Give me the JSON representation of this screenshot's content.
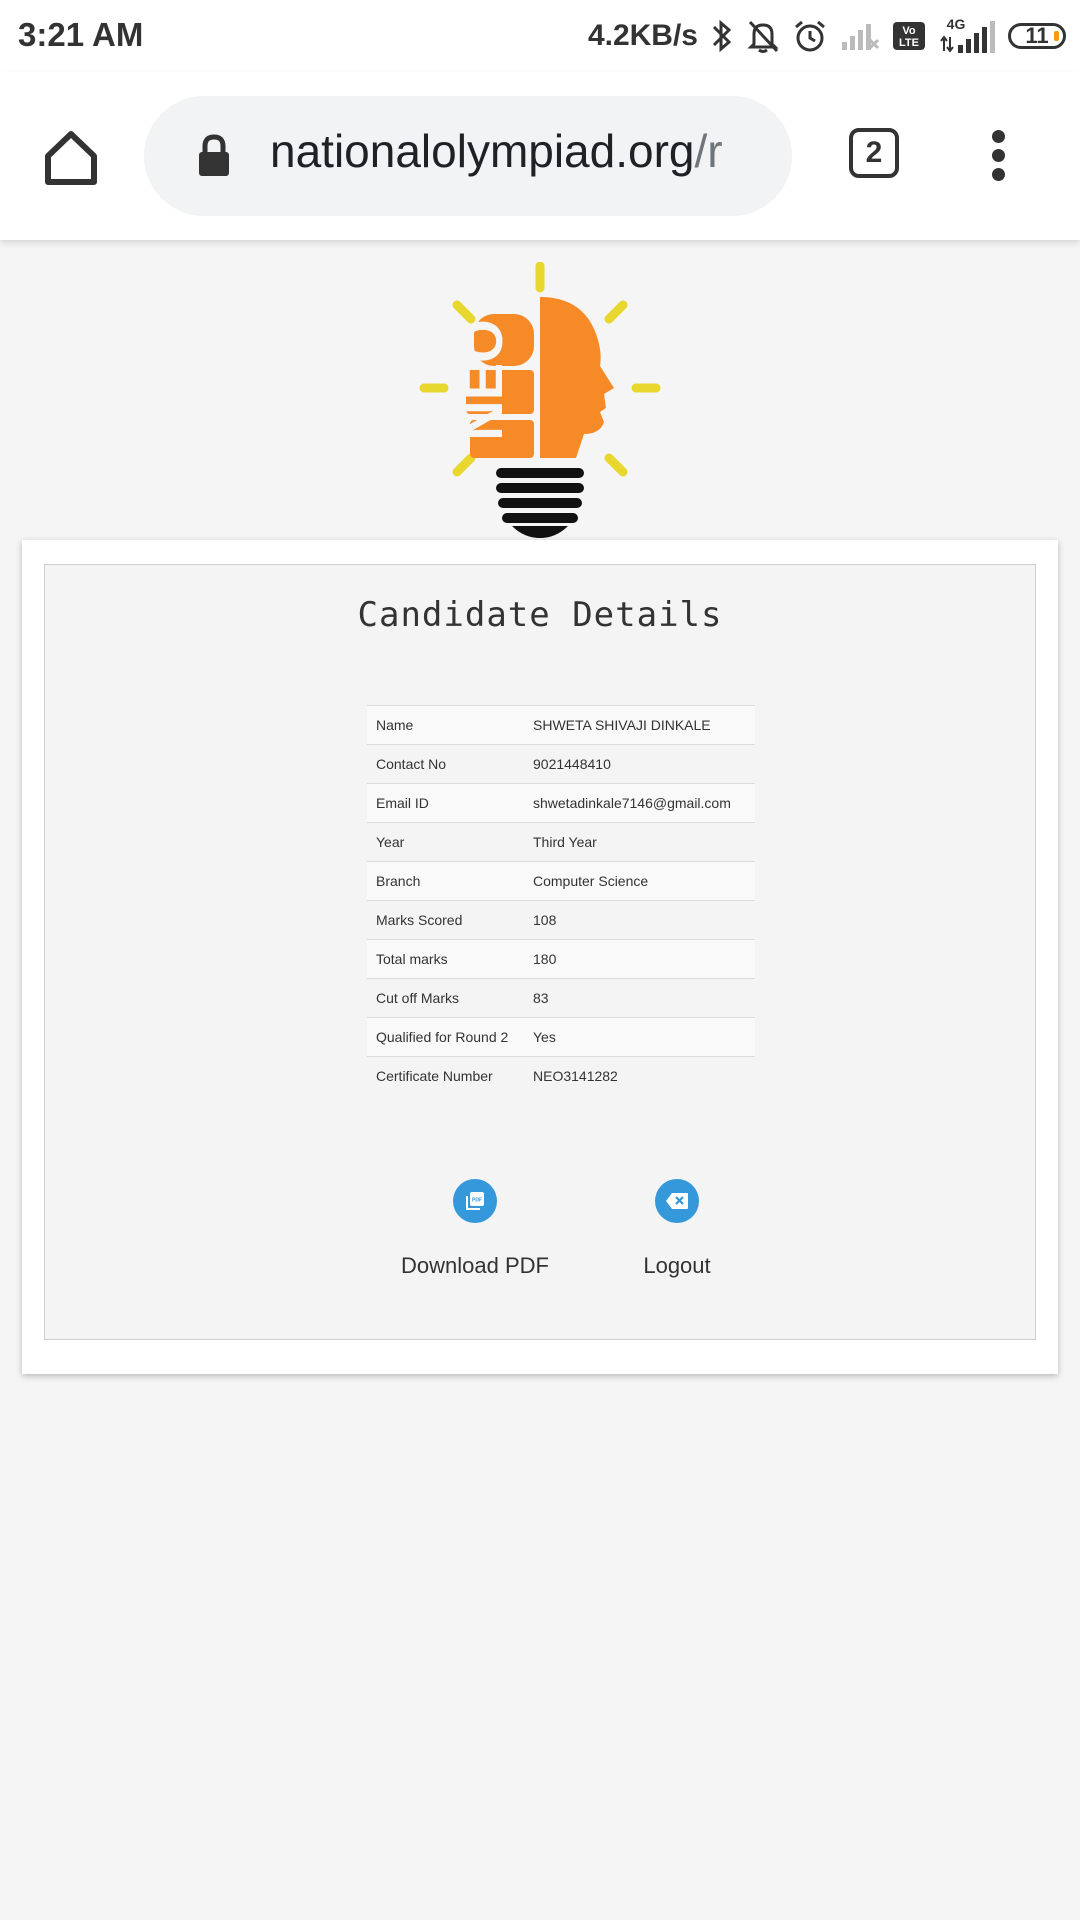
{
  "status_bar": {
    "time": "3:21 AM",
    "net_speed": "4.2KB/s",
    "network_label": "4G",
    "volte_label": "Vo LTE",
    "battery": "11",
    "icons": [
      "bluetooth-icon",
      "bell-off-icon",
      "alarm-icon",
      "no-signal-icon",
      "volte-icon",
      "signal-icon",
      "battery-icon"
    ]
  },
  "browser": {
    "url_host": "nationalolympiad.org",
    "url_path": "/r",
    "tab_count": "2",
    "icons": [
      "home-icon",
      "lock-icon",
      "tabs-icon",
      "more-vert-icon"
    ]
  },
  "logo": {
    "text": "NEO",
    "colors": {
      "orange": "#f58a27",
      "yellow": "#e8d72c",
      "black": "#111111"
    }
  },
  "card": {
    "title": "Candidate Details",
    "rows": [
      {
        "key": "Name",
        "value": "SHWETA SHIVAJI DINKALE"
      },
      {
        "key": "Contact No",
        "value": "9021448410"
      },
      {
        "key": "Email ID",
        "value": "shwetadinkale7146@gmail.com"
      },
      {
        "key": "Year",
        "value": "Third Year"
      },
      {
        "key": "Branch",
        "value": "Computer Science"
      },
      {
        "key": "Marks Scored",
        "value": "108"
      },
      {
        "key": "Total marks",
        "value": "180"
      },
      {
        "key": "Cut off Marks",
        "value": "83"
      },
      {
        "key": "Qualified for Round 2",
        "value": "Yes"
      },
      {
        "key": "Certificate Number",
        "value": "NEO3141282"
      }
    ],
    "actions": {
      "download_label": "Download PDF",
      "logout_label": "Logout",
      "accent": "#3498db"
    }
  }
}
